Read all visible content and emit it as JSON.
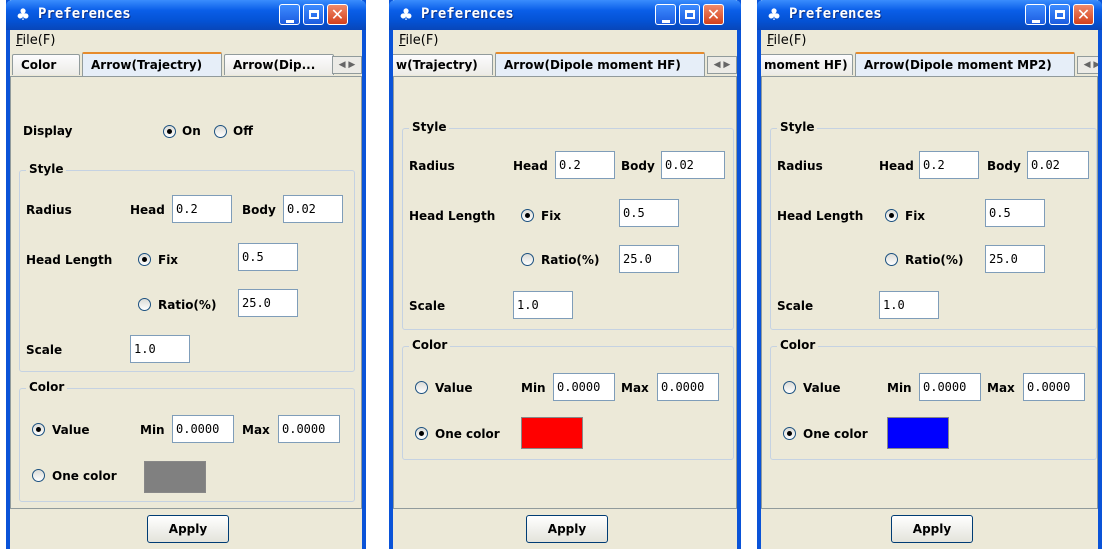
{
  "windows": [
    {
      "title": "Preferences",
      "menu": {
        "accel": "F",
        "rest": "ile(F)"
      },
      "tabs": [
        "Color",
        "Arrow(Trajectry)",
        "Arrow(Dip..."
      ],
      "display": {
        "label": "Display",
        "on": "On",
        "off": "Off"
      },
      "style": {
        "title": "Style",
        "radius": "Radius",
        "head": "Head",
        "head_value": "0.2",
        "body": "Body",
        "body_value": "0.02",
        "head_length": "Head Length",
        "fix": "Fix",
        "fix_value": "0.5",
        "ratio": "Ratio(%)",
        "ratio_value": "25.0",
        "scale": "Scale",
        "scale_value": "1.0"
      },
      "color": {
        "title": "Color",
        "value": "Value",
        "min": "Min",
        "min_value": "0.0000",
        "max": "Max",
        "max_value": "0.0000",
        "one_color": "One color",
        "swatch": "#808080"
      },
      "apply": "Apply"
    },
    {
      "title": "Preferences",
      "menu": {
        "accel": "F",
        "rest": "ile(F)"
      },
      "tabs": [
        "w(Trajectry)",
        "Arrow(Dipole moment HF)"
      ],
      "style": {
        "title": "Style",
        "radius": "Radius",
        "head": "Head",
        "head_value": "0.2",
        "body": "Body",
        "body_value": "0.02",
        "head_length": "Head Length",
        "fix": "Fix",
        "fix_value": "0.5",
        "ratio": "Ratio(%)",
        "ratio_value": "25.0",
        "scale": "Scale",
        "scale_value": "1.0"
      },
      "color": {
        "title": "Color",
        "value": "Value",
        "min": "Min",
        "min_value": "0.0000",
        "max": "Max",
        "max_value": "0.0000",
        "one_color": "One color",
        "swatch": "#ff0000"
      },
      "apply": "Apply"
    },
    {
      "title": "Preferences",
      "menu": {
        "accel": "F",
        "rest": "ile(F)"
      },
      "tabs": [
        "moment HF)",
        "Arrow(Dipole moment MP2)"
      ],
      "style": {
        "title": "Style",
        "radius": "Radius",
        "head": "Head",
        "head_value": "0.2",
        "body": "Body",
        "body_value": "0.02",
        "head_length": "Head Length",
        "fix": "Fix",
        "fix_value": "0.5",
        "ratio": "Ratio(%)",
        "ratio_value": "25.0",
        "scale": "Scale",
        "scale_value": "1.0"
      },
      "color": {
        "title": "Color",
        "value": "Value",
        "min": "Min",
        "min_value": "0.0000",
        "max": "Max",
        "max_value": "0.0000",
        "one_color": "One color",
        "swatch": "#0000ff"
      },
      "apply": "Apply"
    }
  ]
}
